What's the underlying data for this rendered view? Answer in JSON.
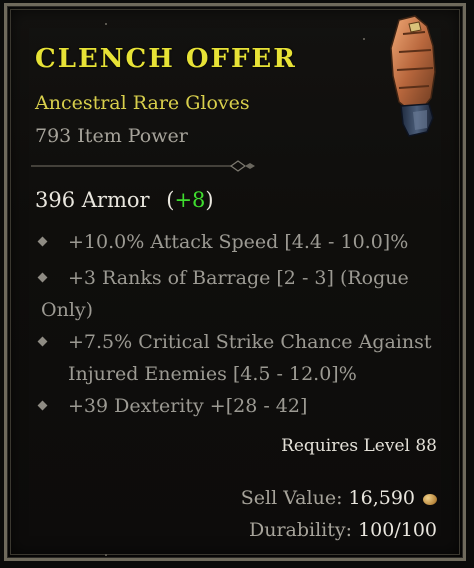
{
  "item": {
    "name": "CLENCH OFFER",
    "rarity_type": "Ancestral Rare Gloves",
    "item_power": "793 Item Power",
    "armor": {
      "base": "396 Armor",
      "bonus": "+8"
    },
    "affixes": [
      {
        "line1": "+10.0% Attack Speed [4.4 - 10.0]%"
      },
      {
        "line1": "+3 Ranks of Barrage [2 - 3] (Rogue",
        "line2": "Only)"
      },
      {
        "line1": "+7.5% Critical Strike Chance Against",
        "line2": "Injured Enemies [4.5 - 12.0]%"
      },
      {
        "line1": "+39 Dexterity +[28 - 42]"
      }
    ],
    "requirement": "Requires Level 88",
    "sell": {
      "label": "Sell Value:",
      "value": "16,590"
    },
    "durability": {
      "label": "Durability:",
      "value": "100/100"
    }
  },
  "icons": {
    "item_image": "gloves-icon",
    "currency": "gold-coin-icon",
    "affix_bullet": "diamond-bullet-icon"
  },
  "colors": {
    "title": "#e7e236",
    "rarity": "#d8cf4c",
    "bonus": "#3fdc2e",
    "border": "#6f6a5c"
  }
}
